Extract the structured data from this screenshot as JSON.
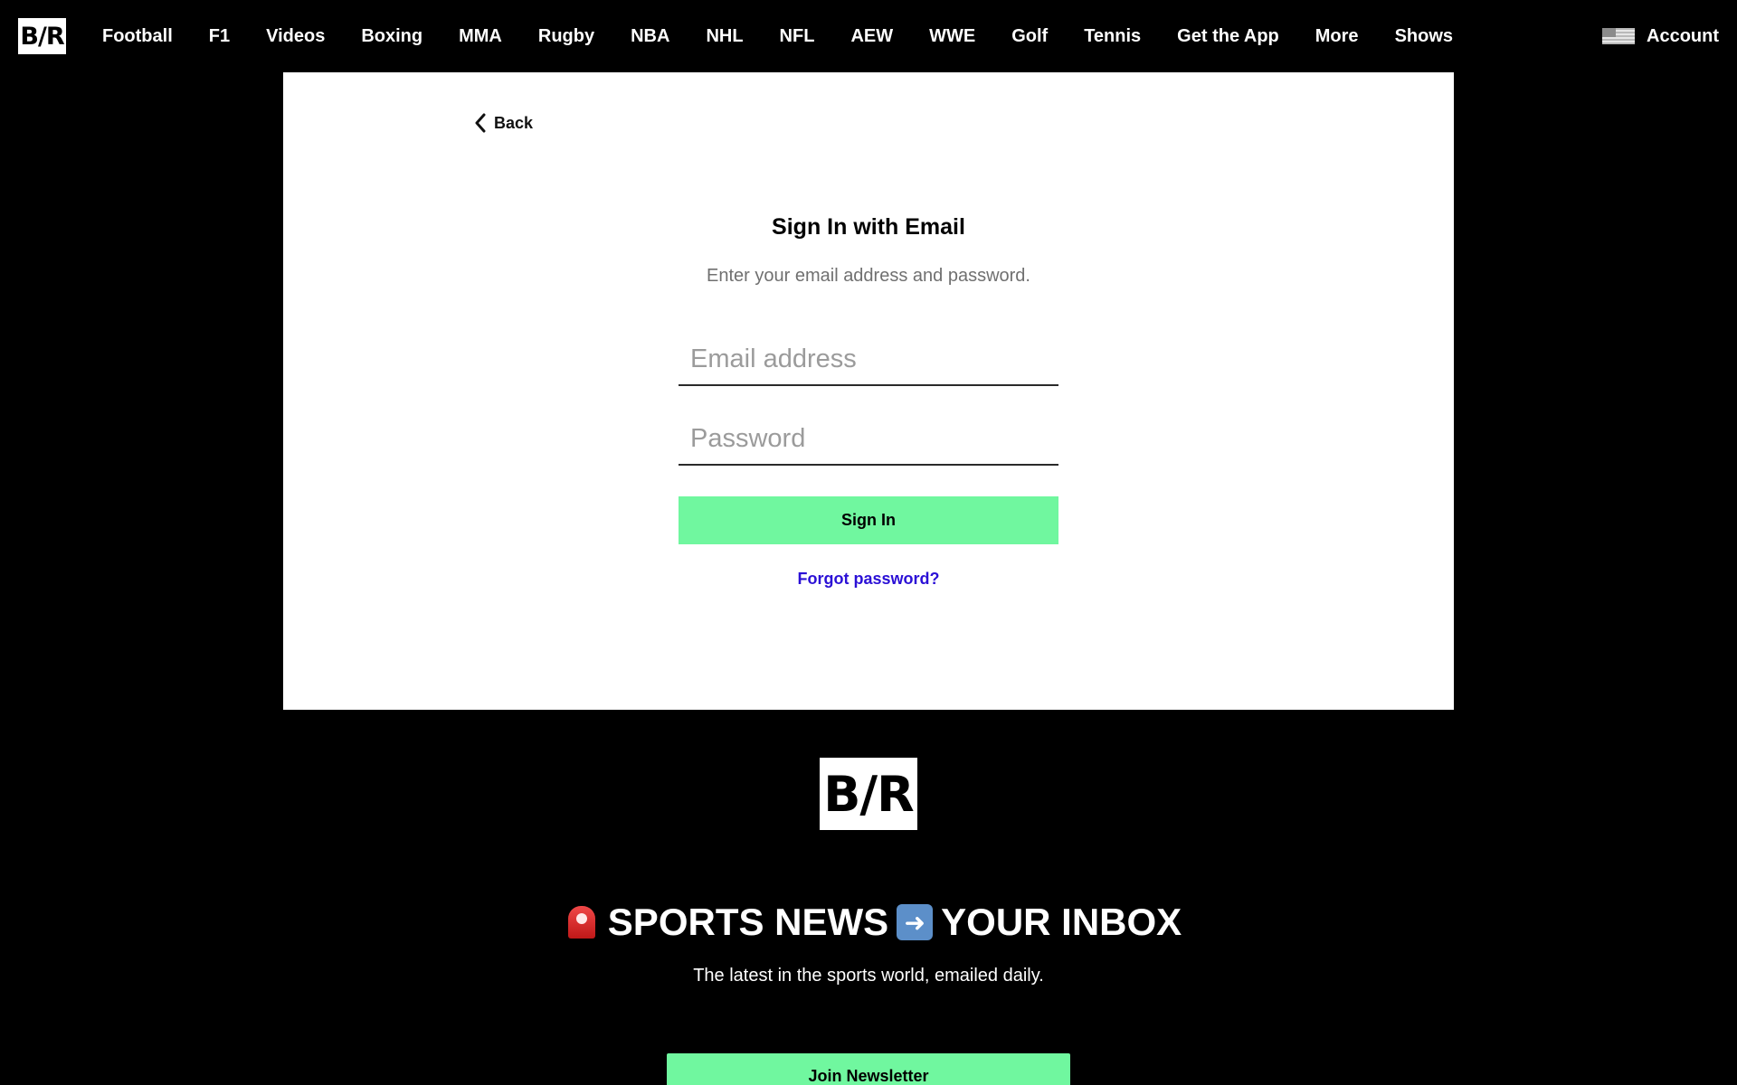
{
  "nav": {
    "logo": "B/R",
    "items": [
      "Football",
      "F1",
      "Videos",
      "Boxing",
      "MMA",
      "Rugby",
      "NBA",
      "NHL",
      "NFL",
      "AEW",
      "WWE",
      "Golf",
      "Tennis",
      "Get the App",
      "More",
      "Shows"
    ],
    "account_label": "Account",
    "flag_icon": "us-flag-icon"
  },
  "signin": {
    "back_label": "Back",
    "title": "Sign In with Email",
    "subtitle": "Enter your email address and password.",
    "email_placeholder": "Email address",
    "password_placeholder": "Password",
    "button_label": "Sign In",
    "forgot_label": "Forgot password?"
  },
  "footer": {
    "logo": "B/R",
    "newsletter_title_part1": "SPORTS NEWS",
    "newsletter_title_part2": "YOUR INBOX",
    "newsletter_subtitle": "The latest in the sports world, emailed daily.",
    "join_label": "Join Newsletter",
    "icons": [
      "siren-icon",
      "right-arrow-icon"
    ]
  },
  "colors": {
    "accent_green": "#70f79f",
    "link_blue": "#2b10d6",
    "background": "#000000"
  }
}
